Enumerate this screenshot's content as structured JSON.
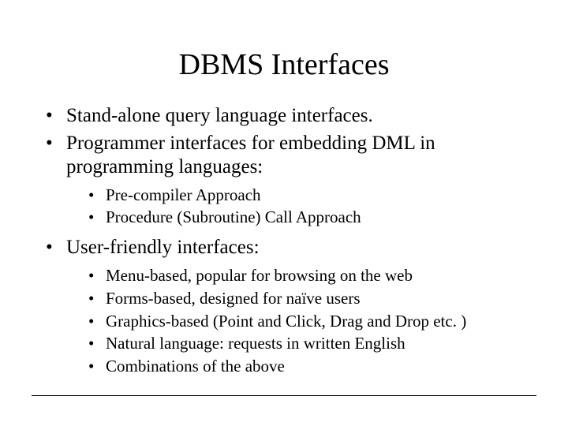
{
  "title": "DBMS Interfaces",
  "bullets": {
    "b0": "Stand-alone query language interfaces.",
    "b1": "Programmer interfaces for embedding DML in programming languages:",
    "b1sub": {
      "s0": "Pre-compiler Approach",
      "s1": "Procedure (Subroutine) Call Approach"
    },
    "b2": "User-friendly interfaces:",
    "b2sub": {
      "s0": "Menu-based, popular for browsing on the web",
      "s1": "Forms-based, designed for naïve users",
      "s2": "Graphics-based (Point and Click, Drag and Drop etc. )",
      "s3": "Natural language: requests in written English",
      "s4": "Combinations of the above"
    }
  }
}
